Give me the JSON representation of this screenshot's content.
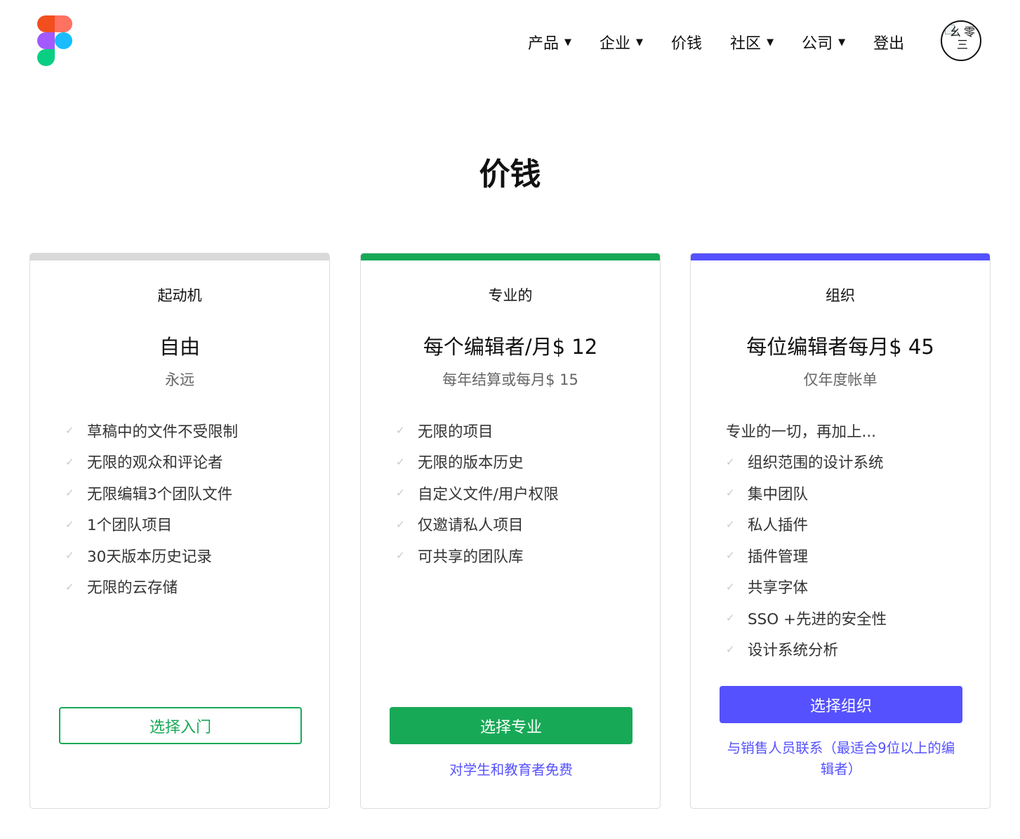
{
  "header": {
    "logo_colors": [
      "#f24e1e",
      "#ff7262",
      "#a259ff",
      "#1abcfe",
      "#0acf83"
    ],
    "nav": [
      {
        "label": "产品",
        "has_caret": true
      },
      {
        "label": "企业",
        "has_caret": true
      },
      {
        "label": "价钱",
        "has_caret": false
      },
      {
        "label": "社区",
        "has_caret": true
      },
      {
        "label": "公司",
        "has_caret": true
      },
      {
        "label": "登出",
        "has_caret": false
      }
    ],
    "caret": "▼",
    "avatar_alt": "幺零三"
  },
  "page": {
    "title": "价钱"
  },
  "plans": [
    {
      "tier": "起动机",
      "price": "自由",
      "billing": "永远",
      "accent": "#d9d9d9",
      "features": [
        "草稿中的文件不受限制",
        "无限的观众和评论者",
        "无限编辑3个团队文件",
        "1个团队项目",
        "30天版本历史记录",
        "无限的云存储"
      ],
      "button": "选择入门"
    },
    {
      "tier": "专业的",
      "price": "每个编辑者/月$ 12",
      "billing": "每年结算或每月$ 15",
      "accent": "#18a957",
      "features": [
        "无限的项目",
        "无限的版本历史",
        "自定义文件/用户权限",
        "仅邀请私人项目",
        "可共享的团队库"
      ],
      "button": "选择专业",
      "link": "对学生和教育者免费"
    },
    {
      "tier": "组织",
      "price": "每位编辑者每月$ 45",
      "billing": "仅年度帐单",
      "accent": "#5551ff",
      "features_intro": "专业的一切，再加上...",
      "features": [
        "组织范围的设计系统",
        "集中团队",
        "私人插件",
        "插件管理",
        "共享字体",
        "SSO +先进的安全性",
        "设计系统分析"
      ],
      "button": "选择组织",
      "link_line1": "与销售人员联系（最适合9位以上的编",
      "link_line2": "辑者）"
    }
  ]
}
